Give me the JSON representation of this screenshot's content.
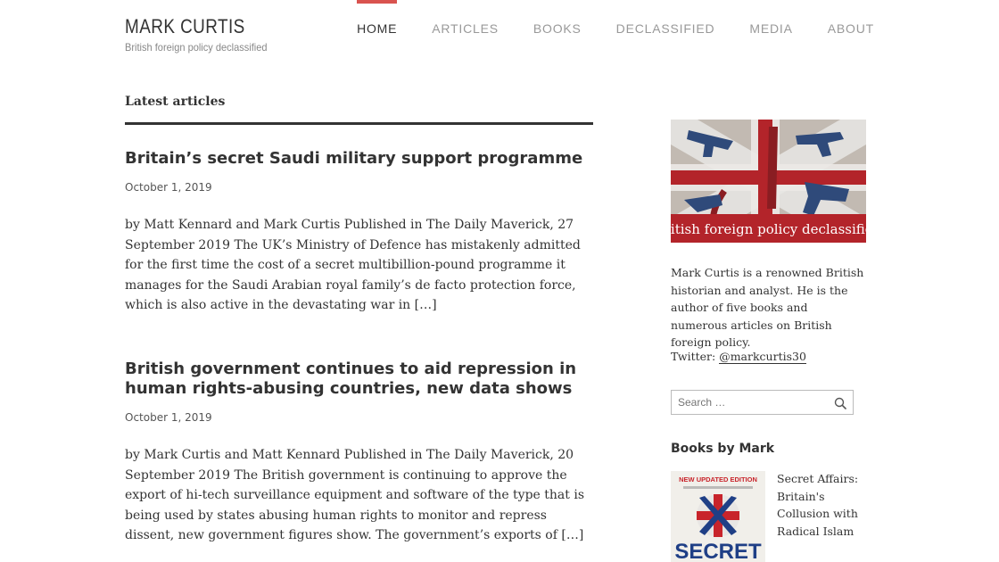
{
  "site": {
    "title": "MARK CURTIS",
    "tagline": "British foreign policy declassified"
  },
  "nav": {
    "items": [
      {
        "label": "HOME",
        "active": true
      },
      {
        "label": "ARTICLES"
      },
      {
        "label": "BOOKS"
      },
      {
        "label": "DECLASSIFIED"
      },
      {
        "label": "MEDIA"
      },
      {
        "label": "ABOUT"
      }
    ]
  },
  "main": {
    "section_title": "Latest articles",
    "posts": [
      {
        "title": "Britain’s secret Saudi military support programme",
        "date": "October 1, 2019",
        "excerpt": "by Matt Kennard and Mark Curtis Published in The Daily Maverick, 27 September 2019   The UK’s Ministry of Defence has mistakenly admitted for the first time the cost of a secret multibillion-pound programme it manages for the Saudi Arabian royal family’s de facto protection force, which is also active in the devastating war in […]"
      },
      {
        "title": "British government continues to aid repression in human rights-abusing countries, new data shows",
        "date": "October 1, 2019",
        "excerpt": "by Mark Curtis and Matt Kennard Published in The Daily Maverick, 20 September 2019   The British government is continuing to approve the export of hi-tech surveillance equipment and software of the type that is being used by states abusing human rights to monitor and repress dissent, new government figures show. The government’s exports of […]"
      }
    ]
  },
  "sidebar": {
    "banner_caption": "British foreign policy declassified",
    "bio": "Mark Curtis is a renowned British historian and analyst. He is the author of five books and numerous articles on British foreign policy.",
    "twitter_label": "Twitter: ",
    "twitter_handle": "@markcurtis30",
    "search_placeholder": "Search …",
    "books_heading": "Books by Mark",
    "book": {
      "cover_badge": "NEW UPDATED EDITION",
      "cover_title": "SECRET",
      "title": "Secret Affairs: Britain's Collusion with Radical Islam"
    }
  },
  "colors": {
    "accent": "#d9534f",
    "text": "#333333",
    "muted": "#999999"
  },
  "icons": {
    "search": "search-icon"
  }
}
